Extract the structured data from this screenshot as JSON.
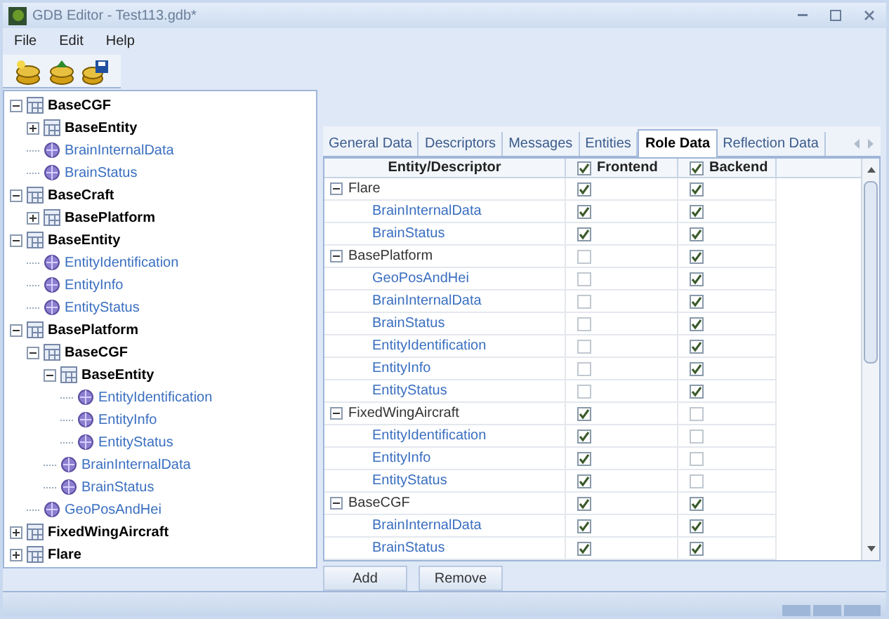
{
  "window": {
    "title": "GDB Editor - Test113.gdb*"
  },
  "menu": [
    "File",
    "Edit",
    "Help"
  ],
  "tree": [
    {
      "label": "BaseCGF",
      "kind": "class",
      "expanded": true,
      "children": [
        {
          "label": "BaseEntity",
          "kind": "class",
          "expanded": false
        },
        {
          "label": "BrainInternalData",
          "kind": "descriptor"
        },
        {
          "label": "BrainStatus",
          "kind": "descriptor"
        }
      ]
    },
    {
      "label": "BaseCraft",
      "kind": "class",
      "expanded": true,
      "children": [
        {
          "label": "BasePlatform",
          "kind": "class",
          "expanded": false
        }
      ]
    },
    {
      "label": "BaseEntity",
      "kind": "class",
      "expanded": true,
      "children": [
        {
          "label": "EntityIdentification",
          "kind": "descriptor"
        },
        {
          "label": "EntityInfo",
          "kind": "descriptor"
        },
        {
          "label": "EntityStatus",
          "kind": "descriptor"
        }
      ]
    },
    {
      "label": "BasePlatform",
      "kind": "class",
      "expanded": true,
      "children": [
        {
          "label": "BaseCGF",
          "kind": "class",
          "expanded": true,
          "children": [
            {
              "label": "BaseEntity",
              "kind": "class",
              "expanded": true,
              "children": [
                {
                  "label": "EntityIdentification",
                  "kind": "descriptor"
                },
                {
                  "label": "EntityInfo",
                  "kind": "descriptor"
                },
                {
                  "label": "EntityStatus",
                  "kind": "descriptor"
                }
              ]
            },
            {
              "label": "BrainInternalData",
              "kind": "descriptor"
            },
            {
              "label": "BrainStatus",
              "kind": "descriptor"
            }
          ]
        },
        {
          "label": "GeoPosAndHei",
          "kind": "descriptor"
        }
      ]
    },
    {
      "label": "FixedWingAircraft",
      "kind": "class",
      "expanded": false
    },
    {
      "label": "Flare",
      "kind": "class",
      "expanded": false
    }
  ],
  "tabs": [
    {
      "label": "General Data",
      "selected": false
    },
    {
      "label": "Descriptors",
      "selected": false
    },
    {
      "label": "Messages",
      "selected": false
    },
    {
      "label": "Entities",
      "selected": false
    },
    {
      "label": "Role Data",
      "selected": true
    },
    {
      "label": "Reflection Data",
      "selected": false
    }
  ],
  "table": {
    "columns": [
      {
        "label": "Entity/Descriptor"
      },
      {
        "label": "Frontend",
        "checked": true
      },
      {
        "label": "Backend",
        "checked": true
      }
    ],
    "groups": [
      {
        "name": "Flare",
        "expanded": true,
        "frontend": true,
        "backend": true,
        "children": [
          {
            "name": "BrainInternalData",
            "frontend": true,
            "backend": true
          },
          {
            "name": "BrainStatus",
            "frontend": true,
            "backend": true
          }
        ]
      },
      {
        "name": "BasePlatform",
        "expanded": true,
        "frontend": false,
        "backend": true,
        "children": [
          {
            "name": "GeoPosAndHei",
            "frontend": false,
            "backend": true
          },
          {
            "name": "BrainInternalData",
            "frontend": false,
            "backend": true
          },
          {
            "name": "BrainStatus",
            "frontend": false,
            "backend": true
          },
          {
            "name": "EntityIdentification",
            "frontend": false,
            "backend": true
          },
          {
            "name": "EntityInfo",
            "frontend": false,
            "backend": true
          },
          {
            "name": "EntityStatus",
            "frontend": false,
            "backend": true
          }
        ]
      },
      {
        "name": "FixedWingAircraft",
        "expanded": true,
        "frontend": true,
        "backend": false,
        "children": [
          {
            "name": "EntityIdentification",
            "frontend": true,
            "backend": false
          },
          {
            "name": "EntityInfo",
            "frontend": true,
            "backend": false
          },
          {
            "name": "EntityStatus",
            "frontend": true,
            "backend": false
          }
        ]
      },
      {
        "name": "BaseCGF",
        "expanded": true,
        "frontend": true,
        "backend": true,
        "children": [
          {
            "name": "BrainInternalData",
            "frontend": true,
            "backend": true
          },
          {
            "name": "BrainStatus",
            "frontend": true,
            "backend": true
          }
        ]
      }
    ]
  },
  "buttons": [
    "Add",
    "Remove"
  ]
}
